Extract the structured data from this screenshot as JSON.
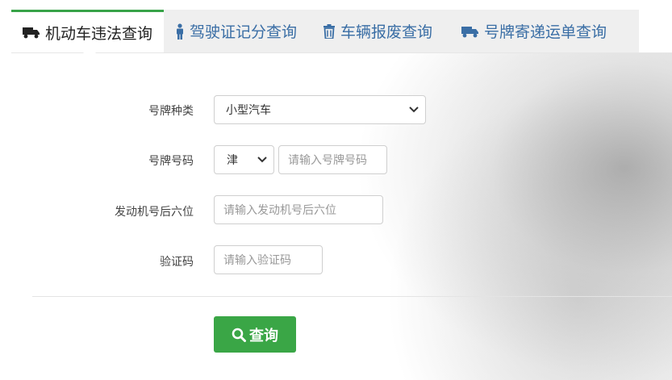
{
  "tabs": [
    {
      "label": "机动车违法查询",
      "icon": "truck-icon",
      "active": true
    },
    {
      "label": "驾驶证记分查询",
      "icon": "person-icon",
      "active": false
    },
    {
      "label": "车辆报废查询",
      "icon": "trash-icon",
      "active": false
    },
    {
      "label": "号牌寄递运单查询",
      "icon": "truck-icon",
      "active": false
    }
  ],
  "form": {
    "plate_type": {
      "label": "号牌种类",
      "value": "小型汽车"
    },
    "plate_number": {
      "label": "号牌号码",
      "province": "津",
      "placeholder": "请输入号牌号码"
    },
    "engine": {
      "label": "发动机号后六位",
      "placeholder": "请输入发动机号后六位"
    },
    "captcha": {
      "label": "验证码",
      "placeholder": "请输入验证码"
    }
  },
  "submit": {
    "label": "查询",
    "icon": "search-icon"
  },
  "colors": {
    "accent": "#3aa646",
    "tab_link": "#3a6ea5"
  }
}
